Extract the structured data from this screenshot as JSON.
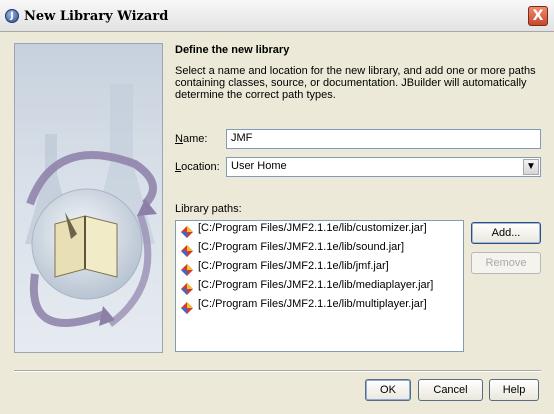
{
  "window": {
    "title": "New Library Wizard",
    "close_label": "X"
  },
  "section": {
    "title": "Define the new library",
    "description": "Select a name and location for the new library, and add one or more paths containing classes, source, or documentation. JBuilder will automatically determine the correct path types."
  },
  "name_field": {
    "label_key": "N",
    "label_rest": "ame:",
    "value": "JMF"
  },
  "location_field": {
    "label_key": "L",
    "label_rest": "ocation:",
    "value": "User Home"
  },
  "library_paths": {
    "label": "Library paths:",
    "items": [
      "[C:/Program Files/JMF2.1.1e/lib/customizer.jar]",
      "[C:/Program Files/JMF2.1.1e/lib/sound.jar]",
      "[C:/Program Files/JMF2.1.1e/lib/jmf.jar]",
      "[C:/Program Files/JMF2.1.1e/lib/mediaplayer.jar]",
      "[C:/Program Files/JMF2.1.1e/lib/multiplayer.jar]"
    ]
  },
  "buttons": {
    "add": "Add...",
    "remove": "Remove",
    "ok": "OK",
    "cancel": "Cancel",
    "help": "Help"
  },
  "colors": {
    "dialog_bg": "#ECE9D8",
    "input_border": "#7F9DB9",
    "panel_bg": "#C7D1DD"
  }
}
